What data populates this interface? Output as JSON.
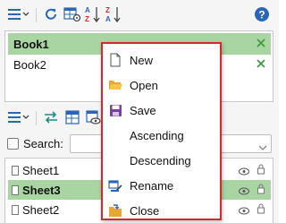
{
  "colors": {
    "accent_green": "#a9d5a2",
    "close_green": "#3c9a3c",
    "menu_border": "#d7262d",
    "help_blue": "#2a66b8"
  },
  "toolbar_top": {
    "icons": [
      "list-menu-icon",
      "refresh-icon",
      "settings-grid-icon",
      "sort-ascending-icon",
      "sort-descending-icon",
      "help-icon"
    ]
  },
  "books": [
    {
      "name": "Book1",
      "selected": true
    },
    {
      "name": "Book2",
      "selected": false
    }
  ],
  "toolbar_second": {
    "icons": [
      "list-menu-icon",
      "swap-icon",
      "table-icon",
      "view-icon",
      "grid-icon"
    ]
  },
  "search": {
    "label": "Search:",
    "value": ""
  },
  "sheets": [
    {
      "name": "Sheet1",
      "selected": false
    },
    {
      "name": "Sheet3",
      "selected": true
    },
    {
      "name": "Sheet2",
      "selected": false
    }
  ],
  "context_menu": {
    "items": [
      {
        "label": "New",
        "icon": "new-file-icon"
      },
      {
        "label": "Open",
        "icon": "open-folder-icon"
      },
      {
        "label": "Save",
        "icon": "save-icon"
      },
      {
        "label": "Ascending",
        "icon": ""
      },
      {
        "label": "Descending",
        "icon": ""
      },
      {
        "label": "Rename",
        "icon": "rename-icon"
      },
      {
        "label": "Close",
        "icon": "close-folder-icon"
      }
    ]
  }
}
